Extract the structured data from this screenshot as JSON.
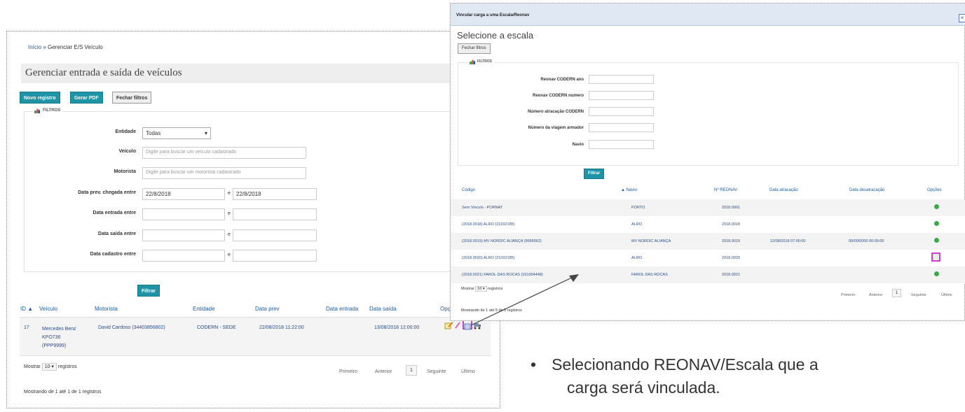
{
  "breadcrumb": {
    "home": "Início",
    "sep": "»",
    "current": "Gerenciar E/S Veículo"
  },
  "page_title": "Gerenciar entrada e saída de veículos",
  "toolbar": {
    "new": "Novo registro",
    "pdf": "Gerar PDF",
    "close_filters": "Fechar filtros"
  },
  "filters": {
    "legend": "FILTROS",
    "entidade_label": "Entidade",
    "entidade_value": "Todas",
    "veiculo_label": "Veículo",
    "veiculo_ph": "Digite para buscar um veículo cadastrado",
    "motorista_label": "Motorista",
    "motorista_ph": "Digite para buscar um motorista cadastrado",
    "prev_label": "Data prev. chegada entre",
    "prev_from": "22/8/2018",
    "prev_to": "22/8/2018",
    "entrada_label": "Data entrada entre",
    "saida_label": "Data saída entre",
    "cadastro_label": "Data cadastro entre",
    "e": "e",
    "button": "Filtrar"
  },
  "table": {
    "headers": [
      "ID",
      "Veículo",
      "Motorista",
      "Entidade",
      "Data prev",
      "Data entrada",
      "Data saída",
      "Opç"
    ],
    "row": {
      "id": "17",
      "veiculo1": "Mercedes Benz",
      "veiculo2": "KPO736",
      "veiculo3": "(PPP9999)",
      "motorista": "David Cardoso (34403856802)",
      "entidade": "CODERN - SEDE",
      "prev": "22/08/2018 11:22:00",
      "saida": "13/08/2018 12:00:00"
    },
    "show": "Mostrar",
    "show_value": "10",
    "show_suffix": "registros",
    "pager": {
      "first": "Primeiro",
      "prev": "Anterior",
      "page": "1",
      "next": "Seguinte",
      "last": "Último"
    },
    "info": "Mostrando de 1 até 1 de 1 registros"
  },
  "modal": {
    "title": "Vincular carga a uma Escala/Reonav",
    "heading": "Selecione a escala",
    "close_filters": "Fechar filtros",
    "legend": "FILTROS",
    "labels": [
      "Reonav CODERN ano",
      "Reonav CODERN numero",
      "Número atracação CODERN",
      "Número da viagem armador",
      "Navio"
    ],
    "button": "Filtrar",
    "headers": [
      "Código",
      "Navio",
      "Nº REONAV",
      "Data atracação",
      "Data desatracação",
      "Opções"
    ],
    "rows": [
      {
        "codigo": "Sem Vinculo - PORNAT",
        "navio": "PORTO",
        "reonav": "2018.0001",
        "atr": "",
        "desatr": ""
      },
      {
        "codigo": "(2018.0018) ALRO (21032185)",
        "navio": "ALRO",
        "reonav": "2018.0018",
        "atr": "",
        "desatr": ""
      },
      {
        "codigo": "(2018.0019) MV NORDIC ALIANÇA (9689562)",
        "navio": "MV NORDIC ALIANÇA",
        "reonav": "2018.0019",
        "atr": "12/08/2018 07:00:00",
        "desatr": "00/00/0000 00:00:00"
      },
      {
        "codigo": "(2018.0020) ALRO (21032185)",
        "navio": "ALRO",
        "reonav": "2018.0020",
        "atr": "",
        "desatr": ""
      },
      {
        "codigo": "(2018.0021) FAROL DAS ROCAS (161004448)",
        "navio": "FAROL DAS ROCAS",
        "reonav": "2018.0021",
        "atr": "",
        "desatr": ""
      }
    ],
    "show": "Mostrar",
    "show_value": "10",
    "show_suffix": "registros",
    "pager": {
      "first": "Primeiro",
      "prev": "Anterior",
      "page": "1",
      "next": "Seguinte",
      "last": "Último"
    },
    "info": "Mostrando de 1 até 5 de 5 registros"
  },
  "note": {
    "line1": "Selecionando REONAV/Escala que a",
    "line2": "carga será vinculada."
  },
  "colors": {
    "accent": "#1f94a7",
    "link": "#1a5ba6",
    "highlight": "#d63bd1",
    "success": "#3aa843"
  }
}
